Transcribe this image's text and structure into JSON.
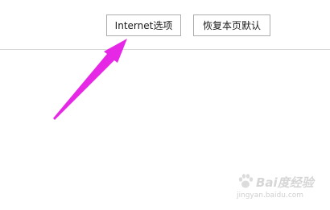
{
  "toolbar": {
    "internet_options_label": "Internet选项",
    "restore_defaults_label": "恢复本页默认"
  },
  "annotation": {
    "arrow_color": "#e628e6"
  },
  "watermark": {
    "brand": "Bai度经验",
    "url": "jingyan.baidu.com"
  }
}
